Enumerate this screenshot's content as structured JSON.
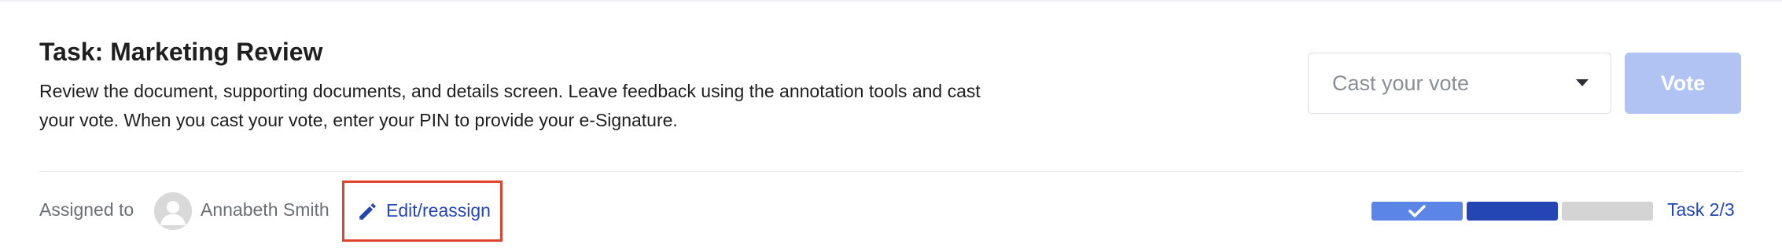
{
  "task": {
    "title": "Task: Marketing Review",
    "description": "Review the document, supporting documents, and details screen. Leave feedback using the annotation tools and cast your vote. When you cast your vote, enter your PIN to provide your e-Signature."
  },
  "vote": {
    "select_placeholder": "Cast your vote",
    "button_label": "Vote"
  },
  "assignment": {
    "label": "Assigned to",
    "assignee": "Annabeth Smith",
    "edit_label": "Edit/reassign"
  },
  "progress": {
    "current": 2,
    "total": 3,
    "label": "Task 2/3",
    "steps": [
      "completed",
      "current",
      "upcoming"
    ]
  },
  "icons": {
    "avatar": "user-avatar-icon",
    "edit": "pencil-icon",
    "dropdown": "caret-down-icon",
    "completed": "check-icon"
  },
  "colors": {
    "primary": "#2446b4",
    "primary_light": "#5b85e6",
    "vote_disabled": "#b1c3f3",
    "highlight": "#e0442b",
    "upcoming": "#d4d4d4"
  }
}
